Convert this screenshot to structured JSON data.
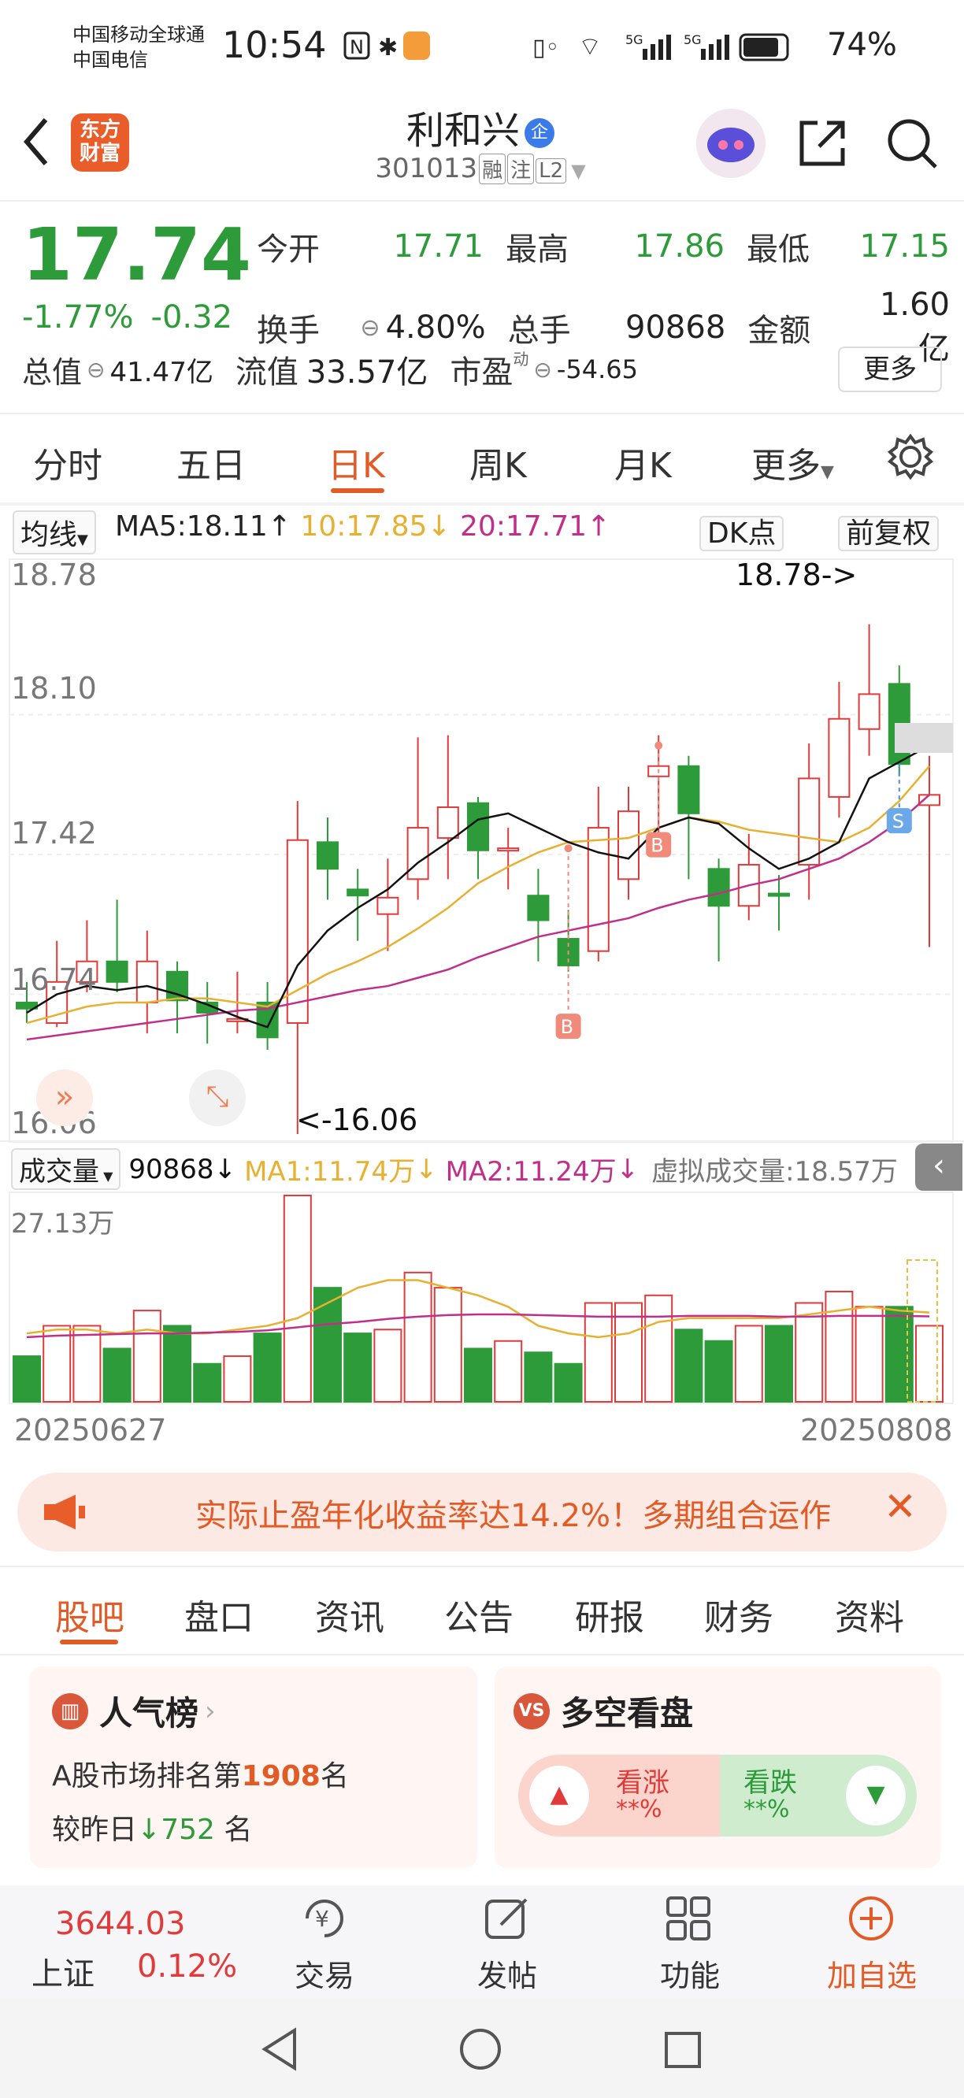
{
  "status_bar": {
    "carrier1": "中国移动全球通",
    "carrier2": "中国电信",
    "time": "10:54",
    "battery": "74%",
    "network": "5G"
  },
  "header": {
    "logo_line1": "东方",
    "logo_line2": "财富",
    "title": "利和兴",
    "title_badge": "企",
    "code": "301013",
    "tags": [
      "融",
      "注",
      "L2"
    ]
  },
  "quote": {
    "price": "17.74",
    "change_pct": "-1.77%",
    "change_amt": "-0.32",
    "open_label": "今开",
    "open": "17.71",
    "high_label": "最高",
    "high": "17.86",
    "low_label": "最低",
    "low": "17.15",
    "turnover_label": "换手",
    "turnover": "4.80%",
    "vol_label": "总手",
    "vol": "90868",
    "amount_label": "金额",
    "amount": "1.60亿",
    "mcap_label": "总值",
    "mcap": "41.47亿",
    "float_label": "流值",
    "float": "33.57亿",
    "pe_label": "市盈",
    "pe_sup": "动",
    "pe": "-54.65",
    "more": "更多"
  },
  "tabs": [
    "分时",
    "五日",
    "日K",
    "周K",
    "月K",
    "更多"
  ],
  "chart_controls": {
    "ma_select": "均线",
    "ma5": "MA5:18.11",
    "ma5_arrow": "↑",
    "ma10": "10:17.85",
    "ma10_arrow": "↓",
    "ma20": "20:17.71",
    "ma20_arrow": "↑",
    "dk": "DK点",
    "adj": "前复权"
  },
  "kline_axis": {
    "y1": "18.78",
    "y2": "18.10",
    "y3": "17.42",
    "y4": "16.74",
    "y5": "16.06",
    "max_note": "18.78->",
    "min_note": "<-16.06",
    "b": "B",
    "s": "S"
  },
  "volume_controls": {
    "select": "成交量",
    "vol": "90868",
    "ma1": "MA1:11.74万",
    "ma2": "MA2:11.24万",
    "virtual": "虚拟成交量:18.57万",
    "vmax": "27.13万",
    "d_start": "20250627",
    "d_end": "20250808"
  },
  "colors": {
    "up": "#e03a3a",
    "down": "#2e9b3a",
    "accent": "#e25b26",
    "ma5": "#111111",
    "ma10": "#e8b030",
    "ma20": "#c0308a"
  },
  "chart_data": {
    "type": "candlestick",
    "dates": [
      "20250627",
      "20250808"
    ],
    "candles": [
      [
        16.67,
        16.7,
        16.8,
        16.6,
        "d"
      ],
      [
        16.6,
        16.8,
        17.0,
        16.58,
        "u"
      ],
      [
        16.8,
        16.9,
        17.1,
        16.75,
        "u"
      ],
      [
        16.9,
        16.8,
        17.2,
        16.75,
        "d"
      ],
      [
        16.7,
        16.9,
        17.05,
        16.55,
        "u"
      ],
      [
        16.85,
        16.71,
        16.9,
        16.55,
        "d"
      ],
      [
        16.7,
        16.65,
        16.8,
        16.5,
        "d"
      ],
      [
        16.62,
        16.62,
        16.85,
        16.55,
        "u"
      ],
      [
        16.7,
        16.53,
        16.8,
        16.47,
        "d"
      ],
      [
        16.6,
        17.49,
        17.68,
        16.06,
        "u"
      ],
      [
        17.48,
        17.35,
        17.6,
        17.2,
        "d"
      ],
      [
        17.25,
        17.22,
        17.35,
        17.0,
        "d"
      ],
      [
        17.13,
        17.21,
        17.4,
        16.95,
        "u"
      ],
      [
        17.3,
        17.55,
        17.99,
        17.2,
        "u"
      ],
      [
        17.5,
        17.65,
        18.0,
        17.3,
        "u"
      ],
      [
        17.67,
        17.44,
        17.7,
        17.3,
        "d"
      ],
      [
        17.45,
        17.45,
        17.55,
        17.25,
        "u"
      ],
      [
        17.22,
        17.1,
        17.35,
        16.9,
        "d"
      ],
      [
        17.01,
        16.88,
        17.15,
        16.85,
        "d"
      ],
      [
        16.95,
        17.55,
        17.75,
        16.9,
        "u"
      ],
      [
        17.3,
        17.63,
        17.75,
        17.2,
        "u"
      ],
      [
        17.8,
        17.85,
        18.0,
        17.43,
        "u"
      ],
      [
        17.85,
        17.62,
        17.9,
        17.3,
        "d"
      ],
      [
        17.35,
        17.17,
        17.4,
        16.9,
        "d"
      ],
      [
        17.17,
        17.37,
        17.52,
        17.1,
        "u"
      ],
      [
        17.22,
        17.23,
        17.32,
        17.05,
        "d"
      ],
      [
        17.37,
        17.79,
        17.96,
        17.2,
        "u"
      ],
      [
        17.7,
        18.08,
        18.26,
        17.6,
        "u"
      ],
      [
        18.03,
        18.2,
        18.54,
        17.9,
        "u"
      ],
      [
        18.25,
        17.86,
        18.34,
        17.8,
        "d"
      ],
      [
        17.66,
        17.71,
        17.9,
        16.97,
        "u"
      ]
    ],
    "ma5": [
      16.65,
      16.74,
      16.78,
      16.76,
      16.78,
      16.74,
      16.69,
      16.63,
      16.58,
      16.88,
      17.05,
      17.16,
      17.25,
      17.38,
      17.48,
      17.59,
      17.62,
      17.55,
      17.48,
      17.43,
      17.4,
      17.55,
      17.6,
      17.57,
      17.45,
      17.35,
      17.4,
      17.48,
      17.79,
      17.87,
      17.95
    ],
    "ma10": [
      16.6,
      16.64,
      16.68,
      16.7,
      16.7,
      16.72,
      16.72,
      16.7,
      16.68,
      16.76,
      16.84,
      16.9,
      16.97,
      17.06,
      17.16,
      17.28,
      17.36,
      17.43,
      17.48,
      17.49,
      17.5,
      17.55,
      17.6,
      17.58,
      17.54,
      17.52,
      17.5,
      17.48,
      17.55,
      17.68,
      17.85
    ],
    "ma20": [
      16.52,
      16.54,
      16.56,
      16.58,
      16.6,
      16.62,
      16.64,
      16.66,
      16.67,
      16.7,
      16.73,
      16.76,
      16.78,
      16.82,
      16.86,
      16.92,
      16.97,
      17.02,
      17.05,
      17.08,
      17.11,
      17.16,
      17.2,
      17.23,
      17.27,
      17.3,
      17.35,
      17.4,
      17.48,
      17.58,
      17.71
    ],
    "volumes": [
      6,
      10,
      10,
      7,
      12,
      10,
      5,
      6,
      9,
      27.13,
      15,
      9,
      9.5,
      17,
      15,
      7,
      8,
      6.5,
      5,
      13,
      13,
      14,
      9.5,
      8,
      10,
      10,
      13,
      14.5,
      12.5,
      12.5,
      10
    ],
    "vol_ma1": [
      9,
      9.5,
      9.5,
      9,
      9.5,
      9,
      9,
      9.5,
      10,
      11,
      13,
      15,
      16,
      16,
      15,
      14,
      12.5,
      10,
      9,
      8.5,
      9,
      10.5,
      11,
      11,
      11,
      11,
      11.5,
      12,
      12.5,
      12,
      11.74
    ],
    "vol_ma2": [
      8.5,
      8.7,
      8.8,
      8.9,
      9,
      9,
      9.1,
      9.2,
      9.4,
      9.8,
      10.2,
      10.5,
      10.9,
      11.2,
      11.4,
      11.5,
      11.5,
      11.4,
      11.3,
      11.2,
      11.2,
      11.2,
      11.3,
      11.3,
      11.3,
      11.2,
      11.2,
      11.3,
      11.3,
      11.3,
      11.24
    ]
  },
  "promo": {
    "text": "实际止盈年化收益率达14.2%！多期组合运作"
  },
  "bottom_tabs": [
    "股吧",
    "盘口",
    "资讯",
    "公告",
    "研报",
    "财务",
    "资料"
  ],
  "popularity": {
    "title": "人气榜",
    "rank_prefix": "A股市场排名第",
    "rank": "1908",
    "rank_suffix": "名",
    "cmp_prefix": "较昨日",
    "cmp": "752",
    "cmp_suffix": "名"
  },
  "sentiment": {
    "title": "多空看盘",
    "up_label": "看涨",
    "up_val": "**%",
    "down_label": "看跌",
    "down_val": "**%"
  },
  "nav": {
    "index_val": "3644.03",
    "index_name": "上证",
    "index_pct": "0.12%",
    "trade": "交易",
    "post": "发帖",
    "func": "功能",
    "add": "加自选"
  }
}
